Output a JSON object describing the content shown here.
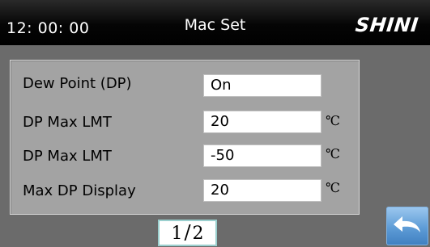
{
  "header": {
    "time": "12: 00: 00",
    "title": "Mac Set",
    "logo": "SHINI"
  },
  "settings": {
    "rows": [
      {
        "label": "Dew Point (DP)",
        "value": "On",
        "unit": ""
      },
      {
        "label": "DP Max LMT",
        "value": "20",
        "unit": "℃"
      },
      {
        "label": "DP Max LMT",
        "value": "-50",
        "unit": "℃"
      },
      {
        "label": "Max DP Display",
        "value": "20",
        "unit": "℃"
      }
    ]
  },
  "pager": {
    "current": "1",
    "total": "2"
  },
  "icons": {
    "back": "return-arrow-icon"
  },
  "colors": {
    "background": "#6b6b6b",
    "panel": "#a3a3a3",
    "header": "#000000",
    "back_button": "#5e9cd6",
    "pager_border": "#9bd0cf"
  }
}
